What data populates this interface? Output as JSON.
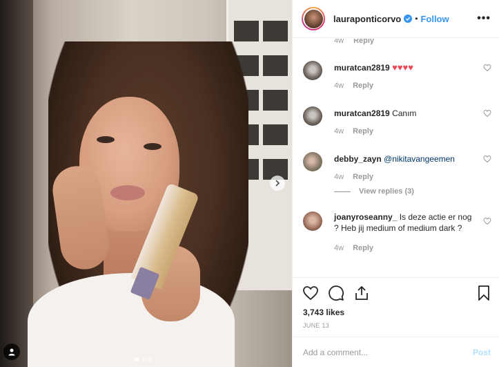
{
  "header": {
    "username": "lauraponticorvo",
    "bullet": "•",
    "follow_label": "Follow",
    "more_label": "•••"
  },
  "partial_comment": {
    "time": "4w",
    "reply": "Reply"
  },
  "comments": [
    {
      "user": "muratcan2819",
      "text": "",
      "hearts": "♥♥♥♥",
      "time": "4w",
      "reply": "Reply"
    },
    {
      "user": "muratcan2819",
      "text": "Canım",
      "time": "4w",
      "reply": "Reply"
    },
    {
      "user": "debby_zayn",
      "mention": "@nikitavangeemen",
      "time": "4w",
      "reply": "Reply",
      "view_replies": "View replies (3)"
    },
    {
      "user": "joanyroseanny_",
      "text": "Is deze actie er nog ? Heb jij medium of medium dark ?",
      "time": "4w",
      "reply": "Reply"
    }
  ],
  "actions": {
    "likes": "3,743 likes",
    "date": "JUNE 13"
  },
  "add_comment": {
    "placeholder": "Add a comment...",
    "post_label": "Post"
  },
  "colors": {
    "link_blue": "#3897f0",
    "heart_red": "#ed4956",
    "muted": "#999999",
    "post_disabled": "#b2dffc"
  },
  "icons": {
    "header": [
      "verified-badge-icon",
      "more-options-icon"
    ],
    "actions": [
      "heart-icon",
      "comment-icon",
      "share-icon",
      "bookmark-icon"
    ],
    "photo": [
      "chevron-right-icon",
      "user-tag-icon"
    ]
  },
  "carousel": {
    "slide_count": 3,
    "active_slide": 1
  }
}
